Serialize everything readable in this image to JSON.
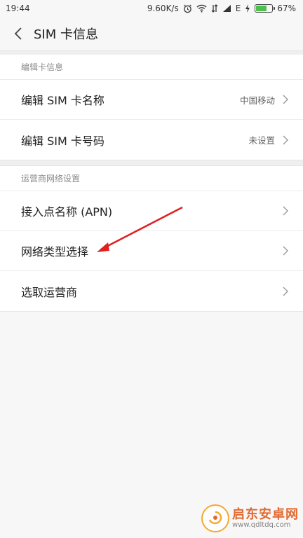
{
  "status_bar": {
    "time": "19:44",
    "speed": "9.60K/s",
    "network": "E",
    "battery_text": "67%",
    "battery_level": 0.67,
    "battery_color": "#4cc24c"
  },
  "header": {
    "title": "SIM 卡信息"
  },
  "sections": [
    {
      "title": "编辑卡信息",
      "rows": [
        {
          "label": "编辑 SIM 卡名称",
          "value": "中国移动"
        },
        {
          "label": "编辑 SIM 卡号码",
          "value": "未设置"
        }
      ]
    },
    {
      "title": "运营商网络设置",
      "rows": [
        {
          "label": "接入点名称 (APN)",
          "value": ""
        },
        {
          "label": "网络类型选择",
          "value": ""
        },
        {
          "label": "选取运营商",
          "value": ""
        }
      ]
    }
  ],
  "annotation": {
    "color": "#e02020"
  },
  "watermark": {
    "name": "启东安卓网",
    "url": "www.qdltdq.com"
  }
}
